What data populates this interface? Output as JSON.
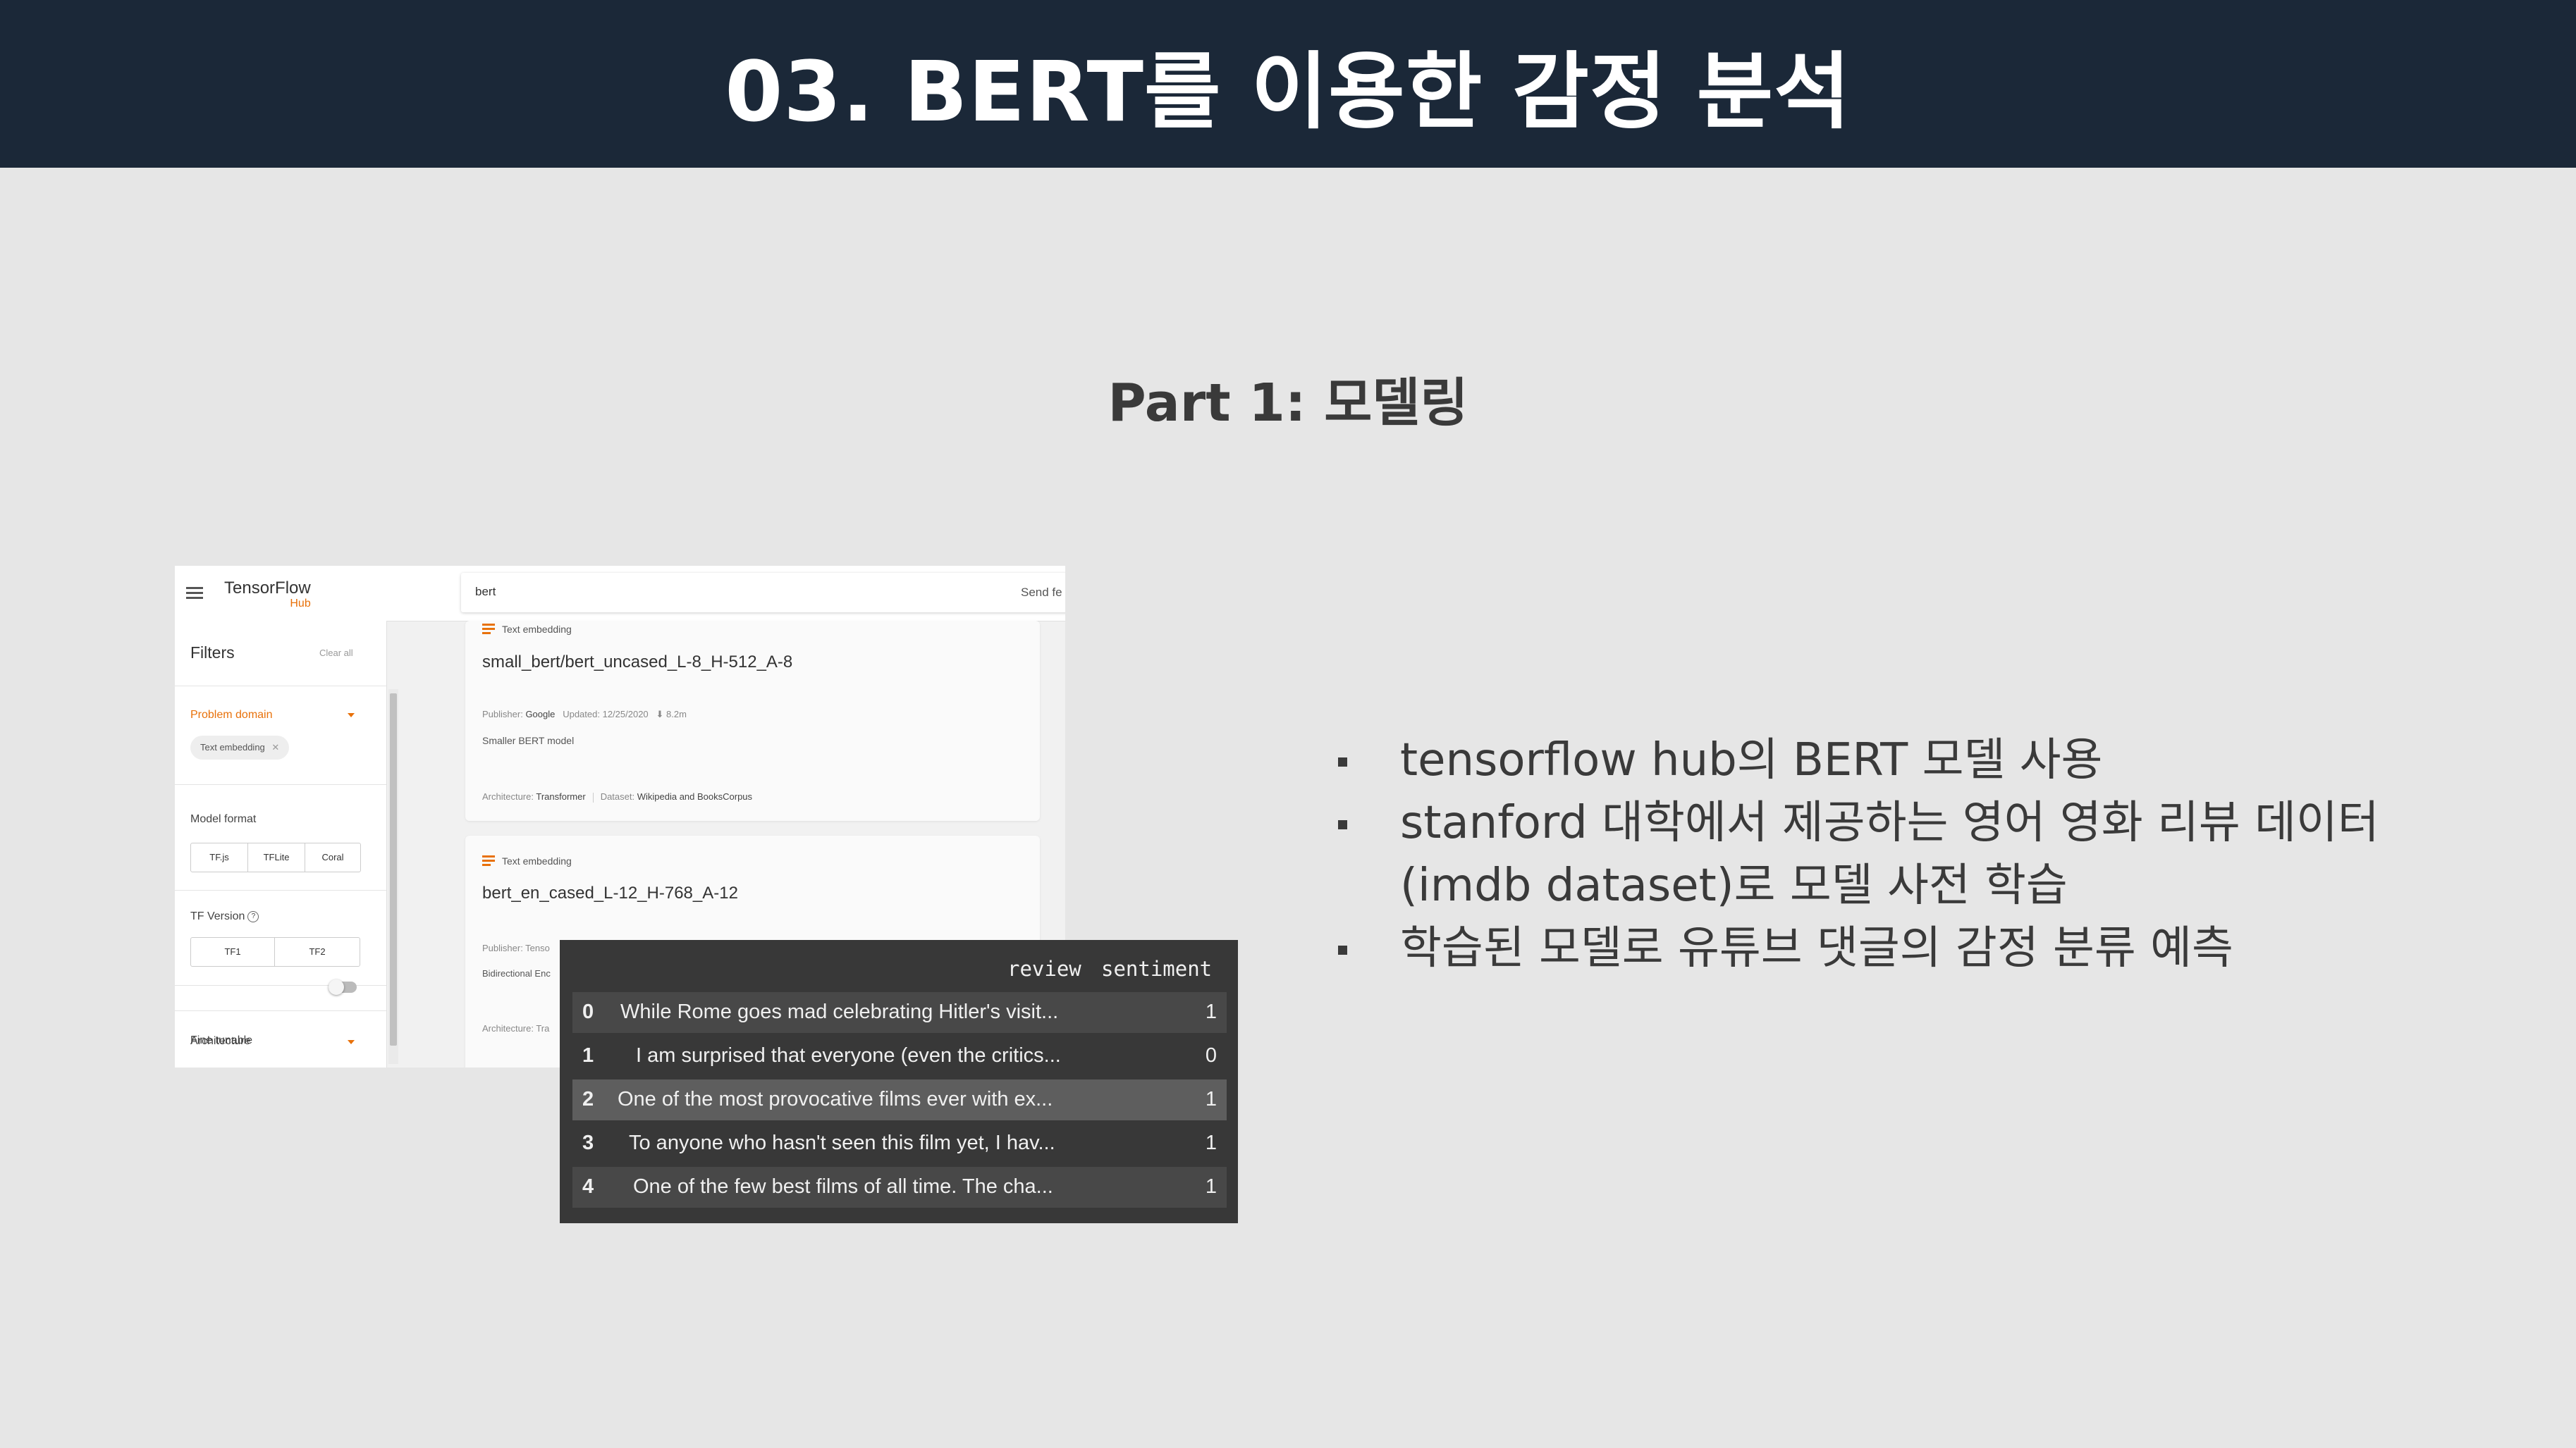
{
  "slide": {
    "title": "03. BERT를 이용한 감정 분석",
    "subtitle": "Part 1: 모델링"
  },
  "tfhub": {
    "logo_top": "TensorFlow",
    "logo_bottom": "Hub",
    "search_value": "bert",
    "send_feedback": "Send fe",
    "sidebar": {
      "filters": "Filters",
      "clear_all": "Clear all",
      "problem_domain": "Problem domain",
      "chip": "Text embedding",
      "model_format": "Model format",
      "formats": [
        "TF.js",
        "TFLite",
        "Coral"
      ],
      "tf_version": "TF Version",
      "versions": [
        "TF1",
        "TF2"
      ],
      "fine_tunable": "Fine tunable",
      "architecture": "Architecture"
    },
    "cards": [
      {
        "type": "Text embedding",
        "title": "small_bert/bert_uncased_L-8_H-512_A-8",
        "publisher_label": "Publisher:",
        "publisher": "Google",
        "updated_label": "Updated:",
        "updated": "12/25/2020",
        "downloads": "8.2m",
        "description": "Smaller BERT model",
        "arch_label": "Architecture:",
        "arch": "Transformer",
        "dataset_label": "Dataset:",
        "dataset": "Wikipedia and BooksCorpus"
      },
      {
        "type": "Text embedding",
        "title": "bert_en_cased_L-12_H-768_A-12",
        "publisher_partial": "Publisher: Tenso",
        "description_partial": "Bidirectional Enc",
        "arch_partial": "Architecture: Tra"
      }
    ]
  },
  "dataframe": {
    "columns": [
      "review",
      "sentiment"
    ],
    "rows": [
      {
        "index": "0",
        "review": "While Rome goes mad celebrating Hitler's visit...",
        "sentiment": "1"
      },
      {
        "index": "1",
        "review": "I am surprised that everyone (even the critics...",
        "sentiment": "0"
      },
      {
        "index": "2",
        "review": "One of the most provocative films ever with ex...",
        "sentiment": "1"
      },
      {
        "index": "3",
        "review": "To anyone who hasn't seen this film yet, I hav...",
        "sentiment": "1"
      },
      {
        "index": "4",
        "review": "One of the few best films of all time. The cha...",
        "sentiment": "1"
      }
    ]
  },
  "bullets": [
    "tensorflow hub의 BERT 모델 사용",
    "stanford 대학에서 제공하는 영어 영화 리뷰 데이터",
    "(imdb dataset)로 모델 사전 학습",
    "학습된 모델로 유튜브 댓글의 감정 분류 예측"
  ],
  "colors": {
    "header_bg": "#1b2838",
    "slide_bg": "#e6e6e6",
    "accent_orange": "#e8710a",
    "dataframe_bg": "#383838"
  }
}
